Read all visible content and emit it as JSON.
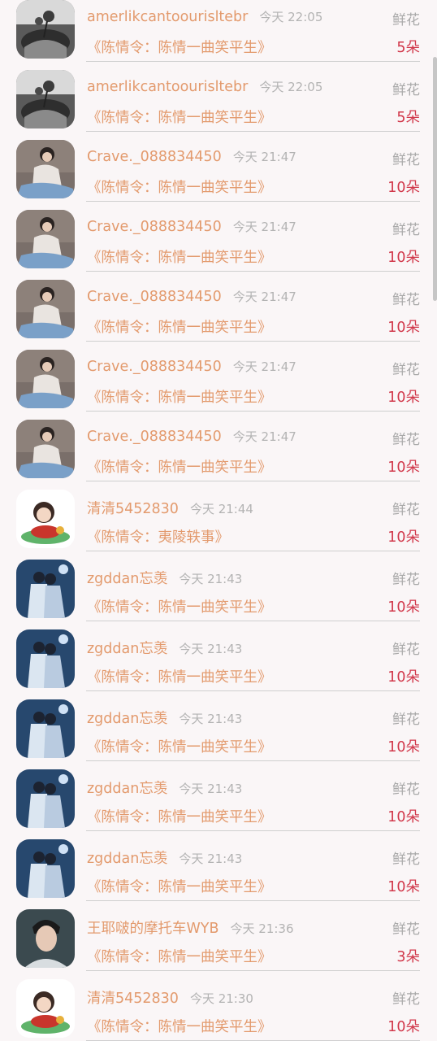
{
  "rows": [
    {
      "name": "amerlikcantoourisltebr",
      "time": "今天 22:05",
      "label": "鲜花",
      "work": "《陈情令：陈情一曲笑平生》",
      "count": "5朵",
      "avatar": "mono-hand-icon"
    },
    {
      "name": "amerlikcantoourisltebr",
      "time": "今天 22:05",
      "label": "鲜花",
      "work": "《陈情令：陈情一曲笑平生》",
      "count": "5朵",
      "avatar": "mono-hand-icon"
    },
    {
      "name": "Crave._088834450",
      "time": "今天 21:47",
      "label": "鲜花",
      "work": "《陈情令：陈情一曲笑平生》",
      "count": "10朵",
      "avatar": "girl-photo-icon"
    },
    {
      "name": "Crave._088834450",
      "time": "今天 21:47",
      "label": "鲜花",
      "work": "《陈情令：陈情一曲笑平生》",
      "count": "10朵",
      "avatar": "girl-photo-icon"
    },
    {
      "name": "Crave._088834450",
      "time": "今天 21:47",
      "label": "鲜花",
      "work": "《陈情令：陈情一曲笑平生》",
      "count": "10朵",
      "avatar": "girl-photo-icon"
    },
    {
      "name": "Crave._088834450",
      "time": "今天 21:47",
      "label": "鲜花",
      "work": "《陈情令：陈情一曲笑平生》",
      "count": "10朵",
      "avatar": "girl-photo-icon"
    },
    {
      "name": "Crave._088834450",
      "time": "今天 21:47",
      "label": "鲜花",
      "work": "《陈情令：陈情一曲笑平生》",
      "count": "10朵",
      "avatar": "girl-photo-icon"
    },
    {
      "name": "清清5452830",
      "time": "今天 21:44",
      "label": "鲜花",
      "work": "《陈情令：夷陵轶事》",
      "count": "10朵",
      "avatar": "cartoon-character-icon"
    },
    {
      "name": "zgddan忘羡",
      "time": "今天 21:43",
      "label": "鲜花",
      "work": "《陈情令：陈情一曲笑平生》",
      "count": "10朵",
      "avatar": "blue-couple-icon"
    },
    {
      "name": "zgddan忘羡",
      "time": "今天 21:43",
      "label": "鲜花",
      "work": "《陈情令：陈情一曲笑平生》",
      "count": "10朵",
      "avatar": "blue-couple-icon"
    },
    {
      "name": "zgddan忘羡",
      "time": "今天 21:43",
      "label": "鲜花",
      "work": "《陈情令：陈情一曲笑平生》",
      "count": "10朵",
      "avatar": "blue-couple-icon"
    },
    {
      "name": "zgddan忘羡",
      "time": "今天 21:43",
      "label": "鲜花",
      "work": "《陈情令：陈情一曲笑平生》",
      "count": "10朵",
      "avatar": "blue-couple-icon"
    },
    {
      "name": "zgddan忘羡",
      "time": "今天 21:43",
      "label": "鲜花",
      "work": "《陈情令：陈情一曲笑平生》",
      "count": "10朵",
      "avatar": "blue-couple-icon"
    },
    {
      "name": "王耶啵的摩托车WYB",
      "time": "今天 21:36",
      "label": "鲜花",
      "work": "《陈情令：陈情一曲笑平生》",
      "count": "3朵",
      "avatar": "man-portrait-icon"
    },
    {
      "name": "清清5452830",
      "time": "今天 21:30",
      "label": "鲜花",
      "work": "《陈情令：陈情一曲笑平生》",
      "count": "10朵",
      "avatar": "cartoon-character-icon"
    }
  ],
  "colors": {
    "name": "#e39a6d",
    "time": "#b3b3b3",
    "count": "#d1374a",
    "background": "#faf6f7"
  }
}
